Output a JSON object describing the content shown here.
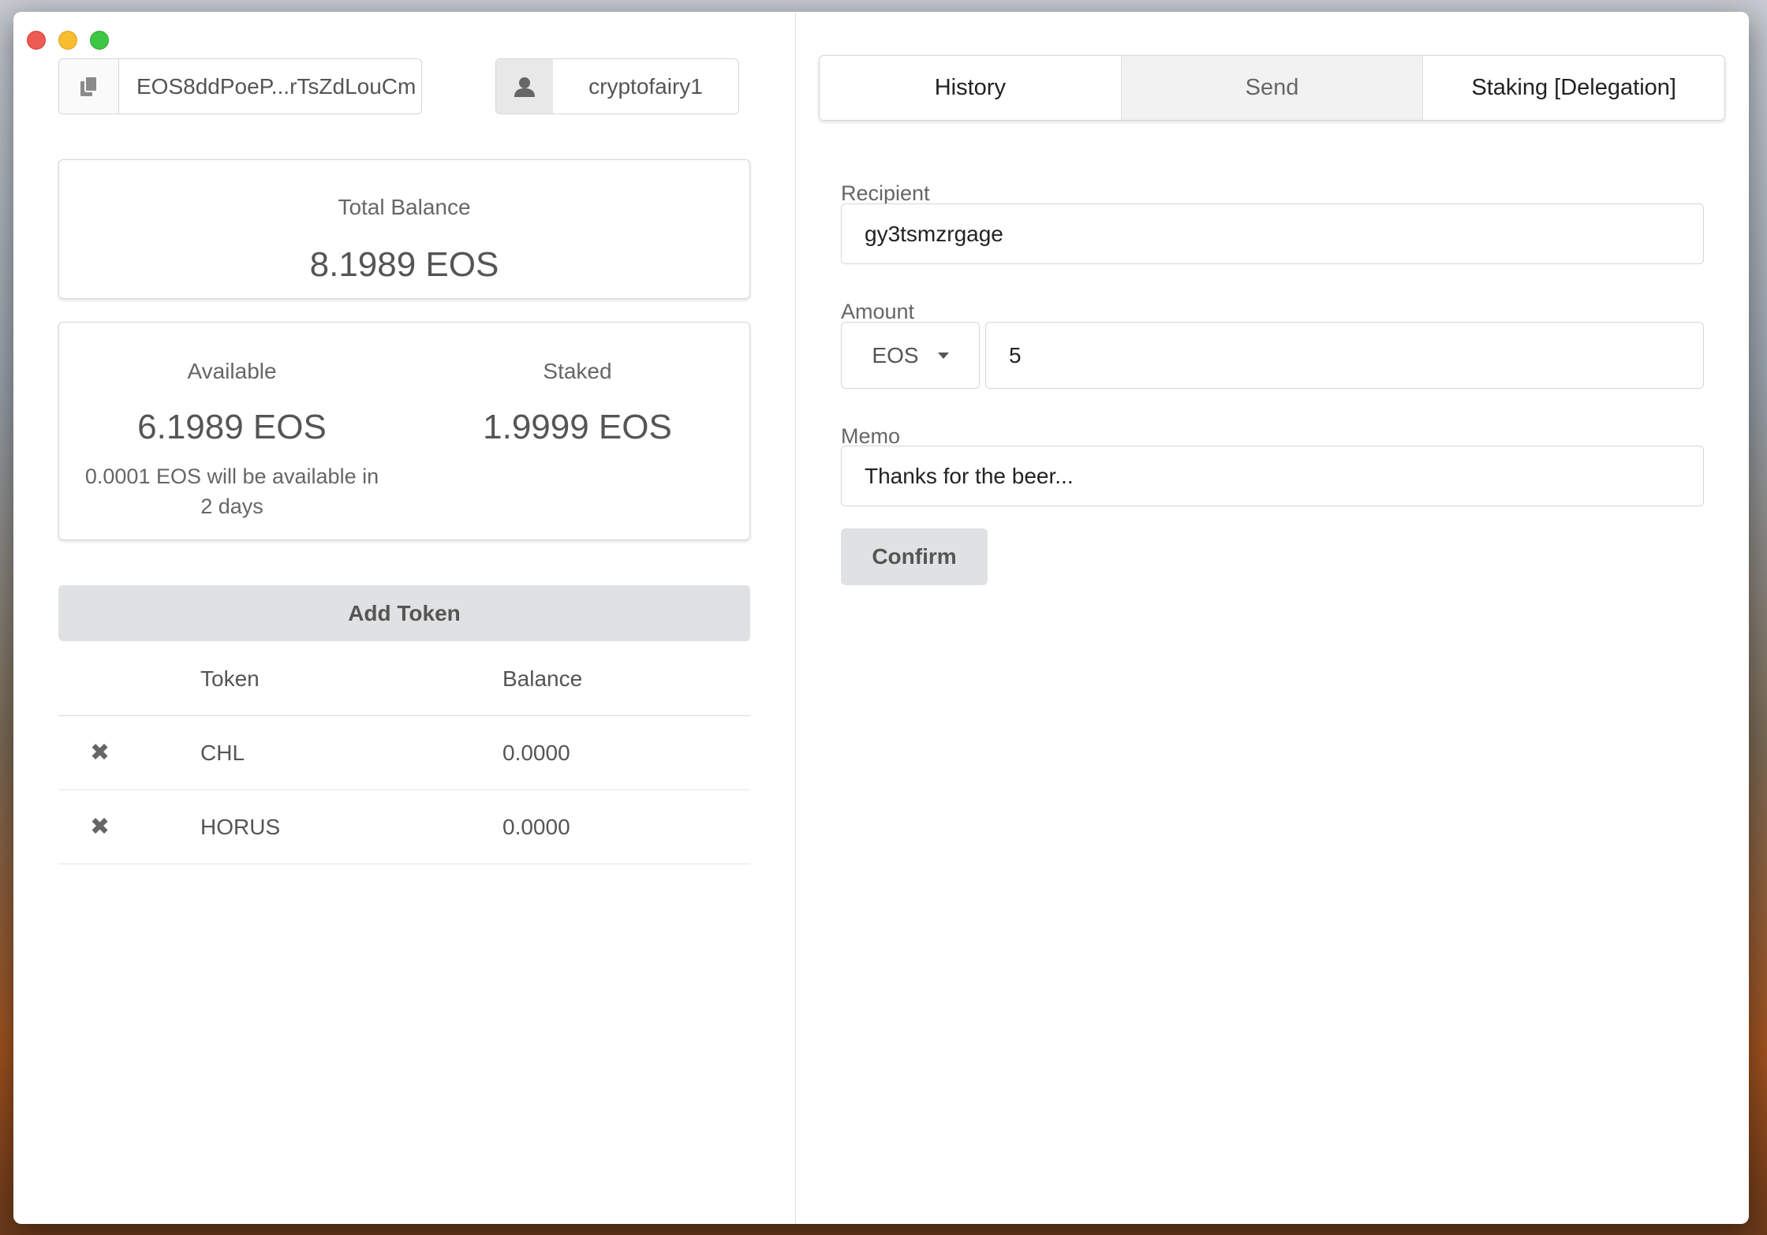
{
  "account": {
    "public_key": "EOS8ddPoeP...rTsZdLouCm",
    "name": "cryptofairy1"
  },
  "balances": {
    "total_label": "Total Balance",
    "total_value": "8.1989 EOS",
    "available_label": "Available",
    "available_value": "6.1989 EOS",
    "staked_label": "Staked",
    "staked_value": "1.9999 EOS",
    "pending_line1": "0.0001 EOS will be available in",
    "pending_line2": "2 days"
  },
  "tokens": {
    "add_label": "Add Token",
    "headers": {
      "token": "Token",
      "balance": "Balance"
    },
    "rows": [
      {
        "remove": "✖",
        "token": "CHL",
        "balance": "0.0000"
      },
      {
        "remove": "✖",
        "token": "HORUS",
        "balance": "0.0000"
      }
    ]
  },
  "tabs": [
    {
      "label": "History",
      "active": false
    },
    {
      "label": "Send",
      "active": true
    },
    {
      "label": "Staking [Delegation]",
      "active": false
    }
  ],
  "send_form": {
    "recipient_label": "Recipient",
    "recipient_value": "gy3tsmzrgage",
    "amount_label": "Amount",
    "currency": "EOS",
    "amount_value": "5",
    "memo_label": "Memo",
    "memo_value": "Thanks for the beer...",
    "confirm_label": "Confirm"
  }
}
